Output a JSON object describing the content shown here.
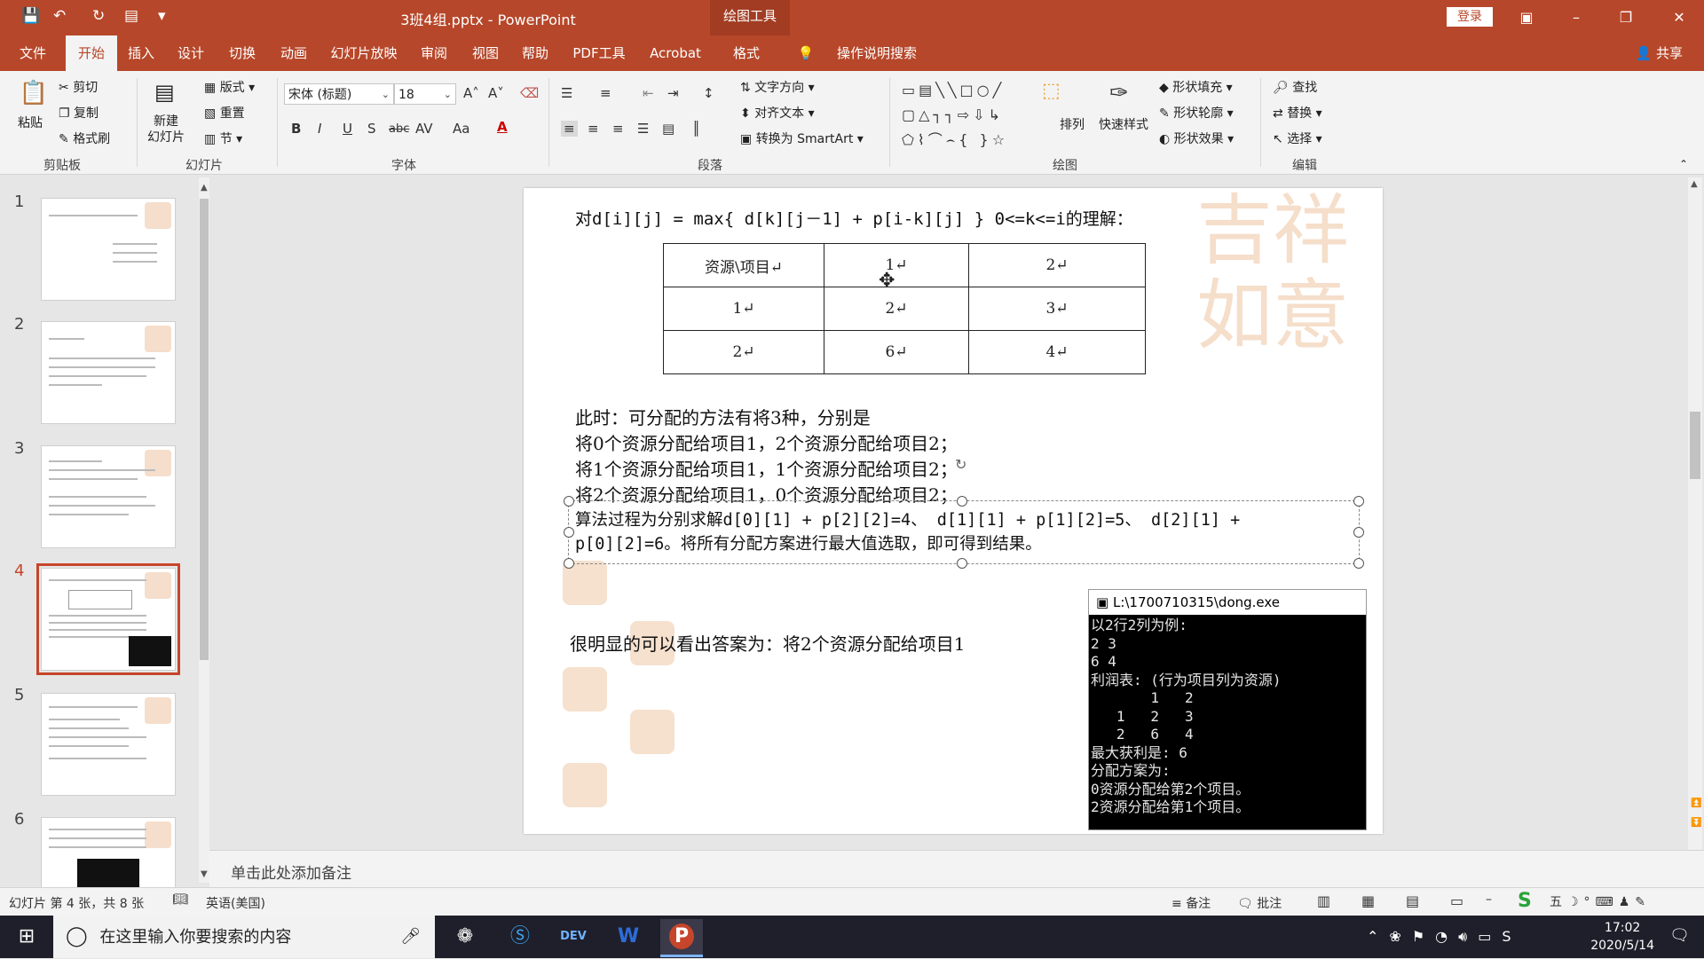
{
  "titlebar": {
    "title": "3班4组.pptx - PowerPoint",
    "tools_label": "绘图工具",
    "login": "登录",
    "quick_icons": [
      "save-icon",
      "undo-icon",
      "redo-icon",
      "present-icon",
      "customize-icon"
    ]
  },
  "tabs": [
    {
      "label": "文件",
      "active": false
    },
    {
      "label": "开始",
      "active": true
    },
    {
      "label": "插入",
      "active": false
    },
    {
      "label": "设计",
      "active": false
    },
    {
      "label": "切换",
      "active": false
    },
    {
      "label": "动画",
      "active": false
    },
    {
      "label": "幻灯片放映",
      "active": false
    },
    {
      "label": "审阅",
      "active": false
    },
    {
      "label": "视图",
      "active": false
    },
    {
      "label": "帮助",
      "active": false
    },
    {
      "label": "PDF工具",
      "active": false
    },
    {
      "label": "Acrobat",
      "active": false
    },
    {
      "label": "格式",
      "active": false
    }
  ],
  "tell_me": "操作说明搜索",
  "share": "共享",
  "ribbon": {
    "clipboard": {
      "paste": "粘贴",
      "cut": "剪切",
      "copy": "复制",
      "format_painter": "格式刷",
      "label": "剪贴板"
    },
    "slides": {
      "new_slide": "新建\n幻灯片",
      "layout": "版式",
      "reset": "重置",
      "section": "节",
      "label": "幻灯片"
    },
    "font": {
      "name": "宋体 (标题)",
      "size": "18",
      "label": "字体",
      "bold": "B",
      "italic": "I",
      "underline": "U",
      "shadow": "S",
      "strike": "abc",
      "spacing": "AV",
      "case": "Aa",
      "color": "A"
    },
    "paragraph": {
      "text_direction": "文字方向",
      "align_text": "对齐文本",
      "smartart": "转换为 SmartArt",
      "label": "段落"
    },
    "drawing": {
      "arrange": "排列",
      "quick_styles": "快速样式",
      "shape_fill": "形状填充",
      "shape_outline": "形状轮廓",
      "shape_effects": "形状效果",
      "label": "绘图"
    },
    "editing": {
      "find": "查找",
      "replace": "替换",
      "select": "选择",
      "label": "编辑"
    }
  },
  "thumbnails": [
    {
      "num": "1",
      "selected": false
    },
    {
      "num": "2",
      "selected": false
    },
    {
      "num": "3",
      "selected": false
    },
    {
      "num": "4",
      "selected": true
    },
    {
      "num": "5",
      "selected": false
    },
    {
      "num": "6",
      "selected": false
    }
  ],
  "slide": {
    "formula": "对d[i][j] = max{ d[k][j－1] + p[i-k][j] } 0<=k<=i的理解：",
    "table": [
      [
        "资源\\项目↵",
        "1↵",
        "2↵"
      ],
      [
        "1↵",
        "2↵",
        "3↵"
      ],
      [
        "2↵",
        "6↵",
        "4↵"
      ]
    ],
    "line1": "此时：可分配的方法有将3种，分别是",
    "line2": "将0个资源分配给项目1，2个资源分配给项目2；",
    "line3": "将1个资源分配给项目1，1个资源分配给项目2；",
    "line4": "将2个资源分配给项目1，0个资源分配给项目2；",
    "line5": "算法过程为分别求解d[0][1] + p[2][2]=4、 d[1][1] + p[1][2]=5、 d[2][1] +",
    "line6": "p[0][2]=6。将所有分配方案进行最大值选取，即可得到结果。",
    "answer": "很明显的可以看出答案为：将2个资源分配给项目1"
  },
  "console": {
    "title": "L:\\1700710315\\dong.exe",
    "lines": "以2行2列为例:\n2 3\n6 4\n利润表: (行为项目列为资源)\n       1   2\n   1   2   3\n   2   6   4\n最大获利是: 6\n分配方案为:\n0资源分配给第2个项目。\n2资源分配给第1个项目。"
  },
  "notes_placeholder": "单击此处添加备注",
  "status": {
    "slide_info": "幻灯片 第 4 张，共 8 张",
    "language": "英语(美国)",
    "notes": "备注",
    "comments": "批注"
  },
  "taskbar": {
    "search_placeholder": "在这里输入你要搜索的内容",
    "time": "17:02",
    "date": "2020/5/14"
  }
}
